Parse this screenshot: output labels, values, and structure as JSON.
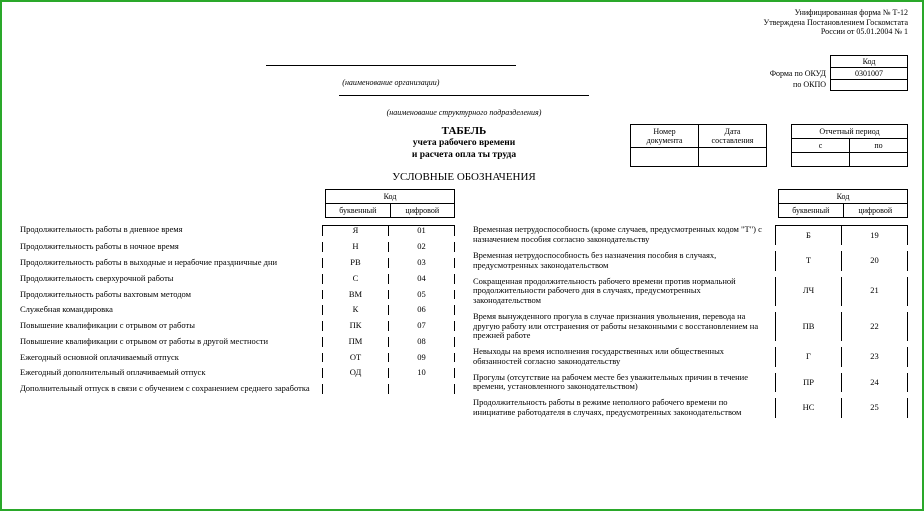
{
  "meta": {
    "form_line": "Унифицированная форма № Т-12",
    "approved_line": "Утверждена Постановлением Госкомстата",
    "country_date": "России от 05.01.2004 № 1"
  },
  "codes": {
    "code_header": "Код",
    "okud_label": "Форма по ОКУД",
    "okud_value": "0301007",
    "okpo_label": "по ОКПО",
    "okpo_value": ""
  },
  "sig": {
    "org": "(наименование организации)",
    "unit": "(наименование структурного подразделения)"
  },
  "title": {
    "main": "ТАБЕЛЬ",
    "line1": "учета рабочего времени",
    "line2": "и расчета опла ты труда",
    "section": "УСЛОВНЫЕ ОБОЗНАЧЕНИЯ"
  },
  "doc_meta": {
    "num_label": "Номер документа",
    "date_label": "Дата составления",
    "period_label": "Отчетный период",
    "from": "с",
    "to": "по"
  },
  "legend_header": {
    "header": "Код",
    "letter": "буквенный",
    "numeric": "цифровой"
  },
  "left_rows": [
    {
      "desc": "Продолжительность работы в дневное время",
      "l": "Я",
      "n": "01"
    },
    {
      "desc": "Продолжительность работы в ночное время",
      "l": "Н",
      "n": "02"
    },
    {
      "desc": "Продолжительность работы в выходные и нерабочие праздничные дни",
      "l": "РВ",
      "n": "03"
    },
    {
      "desc": "Продолжительность сверхурочной работы",
      "l": "С",
      "n": "04"
    },
    {
      "desc": "Продолжительность работы вахтовым методом",
      "l": "ВМ",
      "n": "05"
    },
    {
      "desc": "Служебная командировка",
      "l": "К",
      "n": "06"
    },
    {
      "desc": "Повышение квалификации с отрывом от работы",
      "l": "ПК",
      "n": "07"
    },
    {
      "desc": "Повышение квалификации с отрывом от работы в другой местности",
      "l": "ПМ",
      "n": "08"
    },
    {
      "desc": "Ежегодный основной оплачиваемый отпуск",
      "l": "ОТ",
      "n": "09"
    },
    {
      "desc": "Ежегодный дополнительный оплачиваемый отпуск",
      "l": "ОД",
      "n": "10"
    },
    {
      "desc": "Дополнительный отпуск в связи с обучением с сохранением среднего заработка",
      "l": "",
      "n": ""
    }
  ],
  "right_rows": [
    {
      "desc": "Временная нетрудоспособность (кроме случаев, предусмотренных кодом \"Т\") с назначением пособия согласно законодательству",
      "l": "Б",
      "n": "19"
    },
    {
      "desc": "Временная нетрудоспособность без назначения пособия в случаях, предусмотренных законодательством",
      "l": "Т",
      "n": "20"
    },
    {
      "desc": "Сокращенная продолжительность рабочего времени против нормальной продолжительности рабочего дня в случаях, предусмотренных законодательством",
      "l": "ЛЧ",
      "n": "21"
    },
    {
      "desc": "Время вынужденного прогула в случае признания увольнения, перевода на другую работу или отстранения от работы незаконными с восстановлением на прежней работе",
      "l": "ПВ",
      "n": "22"
    },
    {
      "desc": "Невыходы на время исполнения государственных или общественных обязанностей согласно законодательству",
      "l": "Г",
      "n": "23"
    },
    {
      "desc": "Прогулы (отсутствие на рабочем месте без уважительных причин в течение времени, установленного законодательством)",
      "l": "ПР",
      "n": "24"
    },
    {
      "desc": "Продолжительность работы в режиме неполного рабочего времени по инициативе работодателя в случаях, предусмотренных законодательством",
      "l": "НС",
      "n": "25"
    }
  ]
}
